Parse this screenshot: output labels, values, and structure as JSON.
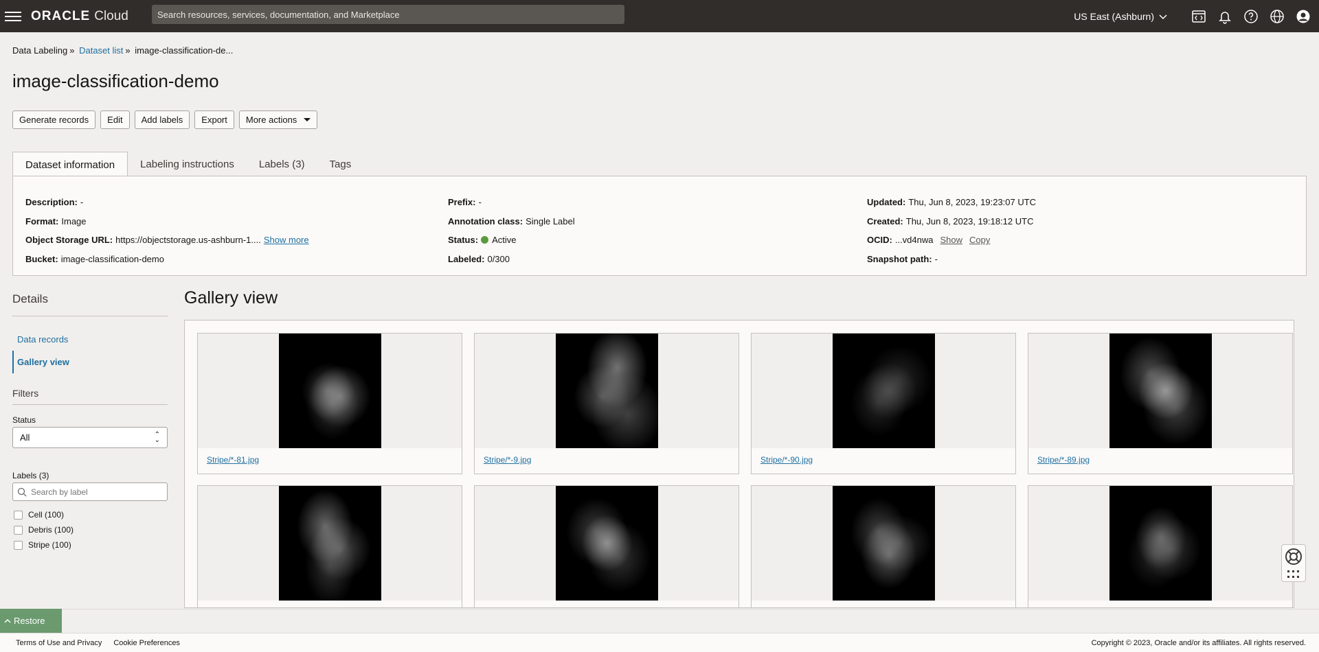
{
  "topbar": {
    "logo_brand": "ORACLE",
    "logo_cloud": "Cloud",
    "search_placeholder": "Search resources, services, documentation, and Marketplace",
    "region": "US East (Ashburn)",
    "icons": [
      "developer-tools-icon",
      "bell-icon",
      "help-icon",
      "globe-icon",
      "user-icon"
    ]
  },
  "breadcrumb": {
    "root": "Data Labeling",
    "dataset_list": "Dataset list",
    "current": "image-classification-de..."
  },
  "page": {
    "title": "image-classification-demo"
  },
  "actions": {
    "generate": "Generate records",
    "edit": "Edit",
    "add_labels": "Add labels",
    "export": "Export",
    "more": "More actions"
  },
  "tabs": {
    "info": "Dataset information",
    "instructions": "Labeling instructions",
    "labels": "Labels (3)",
    "tags": "Tags"
  },
  "info": {
    "description_k": "Description:",
    "description_v": "-",
    "format_k": "Format:",
    "format_v": "Image",
    "url_k": "Object Storage URL:",
    "url_v": "https://objectstorage.us-ashburn-1....",
    "url_more": "Show more",
    "bucket_k": "Bucket:",
    "bucket_v": "image-classification-demo",
    "prefix_k": "Prefix:",
    "prefix_v": "-",
    "annotation_k": "Annotation class:",
    "annotation_v": "Single Label",
    "status_k": "Status:",
    "status_v": "Active",
    "labeled_k": "Labeled:",
    "labeled_v": "0/300",
    "updated_k": "Updated:",
    "updated_v": "Thu, Jun 8, 2023, 19:23:07 UTC",
    "created_k": "Created:",
    "created_v": "Thu, Jun 8, 2023, 19:18:12 UTC",
    "ocid_k": "OCID:",
    "ocid_v": "...vd4nwa",
    "ocid_show": "Show",
    "ocid_copy": "Copy",
    "snapshot_k": "Snapshot path:",
    "snapshot_v": "-"
  },
  "sidebar": {
    "details_title": "Details",
    "nav": [
      "Data records",
      "Gallery view"
    ],
    "filters_title": "Filters",
    "status_label": "Status",
    "status_value": "All",
    "labels_label": "Labels (3)",
    "label_search_placeholder": "Search by label",
    "labels": [
      "Cell (100)",
      "Debris (100)",
      "Stripe (100)"
    ]
  },
  "gallery": {
    "title": "Gallery view",
    "cards": [
      {
        "name": "Stripe/*-81.jpg"
      },
      {
        "name": "Stripe/*-9.jpg"
      },
      {
        "name": "Stripe/*-90.jpg"
      },
      {
        "name": "Stripe/*-89.jpg"
      },
      {
        "name": ""
      },
      {
        "name": ""
      },
      {
        "name": ""
      },
      {
        "name": ""
      }
    ]
  },
  "footer": {
    "restore": "Restore",
    "terms": "Terms of Use and Privacy",
    "cookies": "Cookie Preferences",
    "copyright": "Copyright © 2023, Oracle and/or its affiliates. All rights reserved."
  },
  "colors": {
    "topbar": "#312d2a",
    "link": "#1e6fa0",
    "status_active": "#5a9b3c",
    "restore": "#6a9a6e"
  }
}
